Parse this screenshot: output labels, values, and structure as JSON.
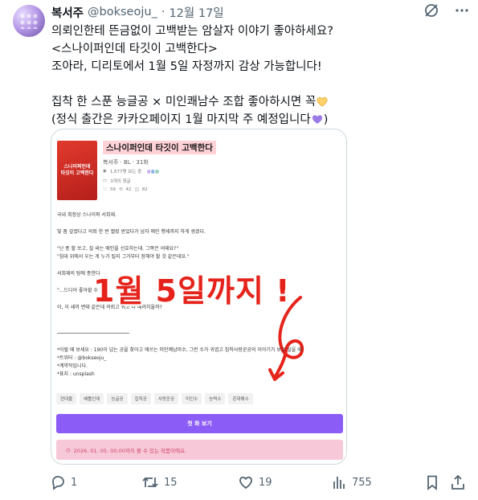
{
  "tweet": {
    "author_name": "복서주",
    "handle": "@bokseoju_",
    "separator": "·",
    "date": "12월 17일",
    "text_lines": [
      "의뢰인한테 뜬금없이 고백받는 암살자 이야기 좋아하세요?",
      "<스나이퍼인데 타깃이 고백한다>",
      "조아라, 디리토에서 1월 5일 자정까지 감상 가능합니다!",
      "",
      "집착 한 스푼 능글공 × 미인쾌남수 조합 좋아하시면 꼭",
      "(정식 출간은 카카오페이지 1월 마지막 주 예정입니다"
    ],
    "line6_suffix": ")"
  },
  "card": {
    "cover_lines": [
      "스나이퍼인데",
      "타깃이 고백한다"
    ],
    "title": "스나이퍼인데 타깃이 고백한다",
    "meta": "복서주 · BL · 31화",
    "stat_views": "1,677명 보는 중",
    "stat_comments": "3개의 댓글",
    "stat_likes": "59",
    "stat_shares": "42",
    "stat_bookmarks": "82",
    "body_lines": [
      "국내 최정상 스나이퍼 서희재.",
      "",
      "빛 좀 갚겠다고 의뢰 한 번 찔렀 받았다가 남자 애인 행세까지 하게 생겼다.",
      "",
      "\"난 종 할 쏘고, 잘 싸는 애인을 선호하는데. 그쪽은 어때요?\"",
      "\"침대 위에서 우는 게 누가 될지 그거부터 정해야 할 것 같은데요.\"",
      "",
      "서희재의 탐에                                          종한다",
      "",
      "\"...드디어 좋아할                    수 있어",
      "",
      "이, 이 새끼 변태 같은데 의뢰고 뭐고 다 때려치울까?"
    ],
    "footer_lines": [
      "*이럴 때 보세요 : 190이 넘는 공을 찾아고 애쓰는 미인쾌남미수, 그런 수가 귀엽고 집착사랑꾼공의 이야기가 보고 싶을 때",
      "*트위터 : @bokseoju_",
      "*계약작입니다.",
      "*표지 : unsplash"
    ],
    "overlay_text": "1월 5일까지 !",
    "tags": [
      "현대물",
      "배틀인데",
      "능글공",
      "집착공",
      "사랑꾼공",
      "미인수",
      "능력수",
      "존대해수"
    ],
    "read_button": "첫 화 보기",
    "notice": "2026. 01. 05. 00:00까지 볼 수 있는 작품이에요."
  },
  "actions": {
    "reply_count": "1",
    "retweet_count": "15",
    "like_count": "19",
    "view_count": "755"
  },
  "colors": {
    "accent_purple": "#8b5cf6",
    "notice_pink": "#f7c8d8",
    "overlay_red": "#e5231b",
    "title_highlight": "#ffd2d8"
  },
  "icons": [
    "grok-icon",
    "more-icon",
    "reply-icon",
    "retweet-icon",
    "like-icon",
    "views-icon",
    "bookmark-icon",
    "share-icon",
    "purple-heart-icon",
    "heart-hands-icon"
  ]
}
